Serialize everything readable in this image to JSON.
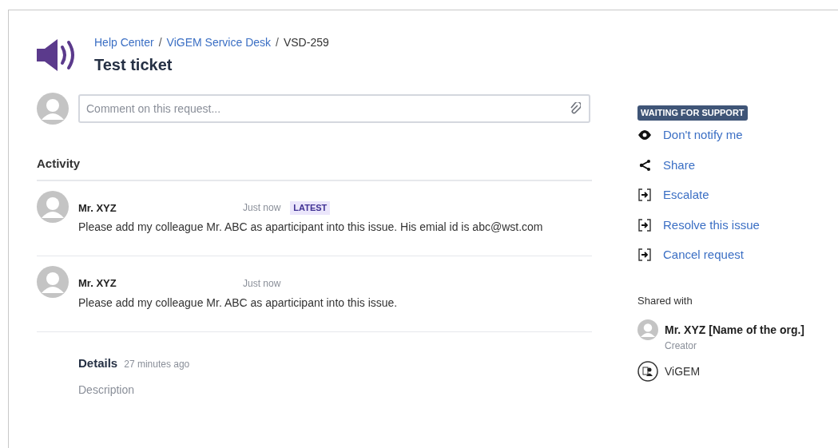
{
  "breadcrumbs": [
    "Help Center",
    "ViGEM Service Desk",
    "VSD-259"
  ],
  "breadcrumb_separator": "/",
  "title": "Test ticket",
  "comment_box": {
    "placeholder": "Comment on this request..."
  },
  "activity": {
    "heading": "Activity",
    "comments": [
      {
        "author": "Mr. XYZ",
        "time": "Just now",
        "badge": "LATEST",
        "text": "Please add my colleague Mr. ABC as aparticipant into this issue. His emial id is abc@wst.com"
      },
      {
        "author": "Mr. XYZ",
        "time": "Just now",
        "text": "Please add my colleague Mr. ABC as aparticipant into this issue."
      }
    ]
  },
  "details": {
    "heading": "Details",
    "time": "27 minutes ago",
    "description_label": "Description"
  },
  "status": "WAITING FOR SUPPORT",
  "actions": [
    {
      "kind": "watch",
      "label": "Don't notify me"
    },
    {
      "kind": "share",
      "label": "Share"
    },
    {
      "kind": "transition",
      "label": "Escalate"
    },
    {
      "kind": "transition",
      "label": "Resolve this issue"
    },
    {
      "kind": "transition",
      "label": "Cancel request"
    }
  ],
  "shared_with": {
    "heading": "Shared with",
    "people": [
      {
        "kind": "user",
        "name": "Mr. XYZ [Name of the org.]",
        "role": "Creator"
      },
      {
        "kind": "org",
        "name": "ViGEM"
      }
    ]
  }
}
